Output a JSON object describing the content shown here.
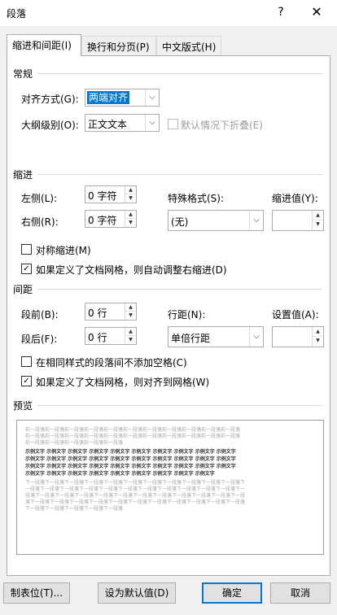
{
  "window": {
    "title": "段落",
    "help": "?",
    "close": "✕"
  },
  "tabs": [
    {
      "label": "缩进和间距(I)",
      "active": true
    },
    {
      "label": "换行和分页(P)",
      "active": false
    },
    {
      "label": "中文版式(H)",
      "active": false
    }
  ],
  "general": {
    "heading": "常规",
    "alignment_label": "对齐方式(G):",
    "alignment_value": "两端对齐",
    "outline_label": "大纲级别(O):",
    "outline_value": "正文文本",
    "collapse_label": "默认情况下折叠(E)"
  },
  "indent": {
    "heading": "缩进",
    "left_label": "左侧(L):",
    "left_value": "0 字符",
    "right_label": "右侧(R):",
    "right_value": "0 字符",
    "special_label": "特殊格式(S):",
    "special_value": "(无)",
    "indent_value_label": "缩进值(Y):",
    "indent_value": "",
    "mirror_label": "对称缩进(M)",
    "mirror_checked": false,
    "auto_adjust_label": "如果定义了文档网格，则自动调整右缩进(D)",
    "auto_adjust_checked": true
  },
  "spacing": {
    "heading": "间距",
    "before_label": "段前(B):",
    "before_value": "0 行",
    "after_label": "段后(F):",
    "after_value": "0 行",
    "line_spacing_label": "行距(N):",
    "line_spacing_value": "单倍行距",
    "at_label": "设置值(A):",
    "at_value": "",
    "no_space_label": "在相同样式的段落间不添加空格(C)",
    "no_space_checked": false,
    "snap_grid_label": "如果定义了文档网格，则对齐到网格(W)",
    "snap_grid_checked": true
  },
  "preview": {
    "heading": "预览",
    "prev_lines": [
      "前一段落前一段落前一段落前一段落前一段落前一段落前一段落前一段落前一段落前一段落前一段落",
      "前一段落前一段落前一段落前一段落前一段落前一段落前一段落前一段落前一段落前一段落前一段落",
      "前一段落前一段落前一段落前一段落前一段落"
    ],
    "sample_lines": [
      "示例文字 示例文字 示例文字 示例文字 示例文字 示例文字 示例文字 示例文字 示例文字 示例文字",
      "示例文字 示例文字 示例文字 示例文字 示例文字 示例文字 示例文字 示例文字 示例文字 示例文字",
      "示例文字 示例文字 示例文字 示例文字 示例文字 示例文字 示例文字 示例文字 示例文字 示例文字",
      "示例文字 示例文字 示例文字 示例文字 示例文字 示例文字 示例文字 示例文字 示例文字"
    ],
    "next_lines": [
      "下一段落下一段落下一段落下一段落下一段落下一段落下一段落下一段落下一段落下一段落下一段落下",
      "一段落下一段落下一段落下一段落下一段落下一段落下一段落下一段落下一段落下一段落下一段落下一",
      "段落下一段落下一段落下一段落下一段落下一段落下一段落下一段落下一段落下一段落下一段落下一段",
      "落下一段落下一段落下一段落下一段落下一段落下一段落下一段落下一段落下一段落下一段落下一段落",
      "下一段落下一段落下一段落下一段落下一段落"
    ]
  },
  "buttons": {
    "tabs_btn": "制表位(T)...",
    "set_default": "设为默认值(D)",
    "ok": "确定",
    "cancel": "取消"
  },
  "colors": {
    "accent": "#0078d7",
    "dialog_bg": "#f0f0f0"
  }
}
